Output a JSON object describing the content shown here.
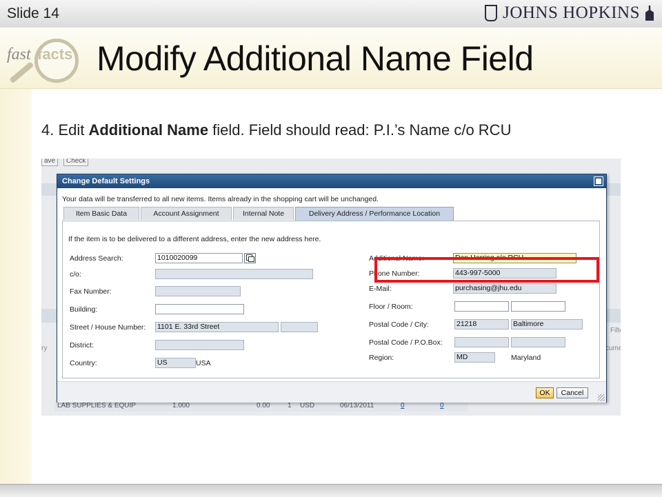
{
  "slide": {
    "number": "Slide 14",
    "logo_text": "JOHNS HOPKINS"
  },
  "fastfacts": {
    "fast": "fast",
    "facts": "facts"
  },
  "title": "Modify Additional Name Field",
  "instruction": {
    "prefix": "4. Edit ",
    "bold": "Additional Name",
    "suffix": " field. Field should read: P.I.’s Name c/o RCU"
  },
  "background_app": {
    "buttons": [
      "ave",
      "Check"
    ],
    "side_texts": [
      "ry",
      "Filte",
      "cume"
    ],
    "row": {
      "description": "LAB SUPPLIES & EQUIP",
      "quantity": "1.000",
      "price": "0.00",
      "per": "1",
      "currency": "USD",
      "date": "06/13/2011",
      "link1": "0",
      "link2": "0"
    }
  },
  "dialog": {
    "title": "Change Default Settings",
    "info": "Your data will be transferred to all new items. Items already in the shopping cart will be unchanged.",
    "tabs": [
      "Item Basic Data",
      "Account Assignment",
      "Internal Note",
      "Delivery Address / Performance Location"
    ],
    "active_tab": "Delivery Address / Performance Location",
    "panel_intro": "If the item is to be delivered to a different address, enter the new address here.",
    "left_fields": {
      "address_search": {
        "label": "Address Search:",
        "value": "1010020099"
      },
      "co": {
        "label": "c/o:",
        "value": ""
      },
      "fax": {
        "label": "Fax Number:",
        "value": ""
      },
      "building": {
        "label": "Building:",
        "value": ""
      },
      "street": {
        "label": "Street / House Number:",
        "value": "1101 E. 33rd Street",
        "house": ""
      },
      "district": {
        "label": "District:",
        "value": ""
      },
      "country": {
        "label": "Country:",
        "value": "US",
        "name": "USA"
      }
    },
    "right_fields": {
      "additional_name": {
        "label": "Additional Name:",
        "value": "Dan Herring c/o RCU"
      },
      "phone": {
        "label": "Phone Number:",
        "value": "443-997-5000"
      },
      "email": {
        "label": "E-Mail:",
        "value": "purchasing@jhu.edu"
      },
      "floor_room": {
        "label": "Floor / Room:",
        "floor": "",
        "room": ""
      },
      "postal_city": {
        "label": "Postal Code / City:",
        "postal": "21218",
        "city": "Baltimore"
      },
      "po_box": {
        "label": "Postal Code / P.O.Box:",
        "postal": "",
        "box": ""
      },
      "region": {
        "label": "Region:",
        "code": "MD",
        "name": "Maryland"
      }
    },
    "buttons": {
      "ok": "OK",
      "cancel": "Cancel"
    }
  },
  "colors": {
    "highlight_box": "#e8151b",
    "dialog_header": "#1e4a7c",
    "ok_button": "#f5c960"
  }
}
